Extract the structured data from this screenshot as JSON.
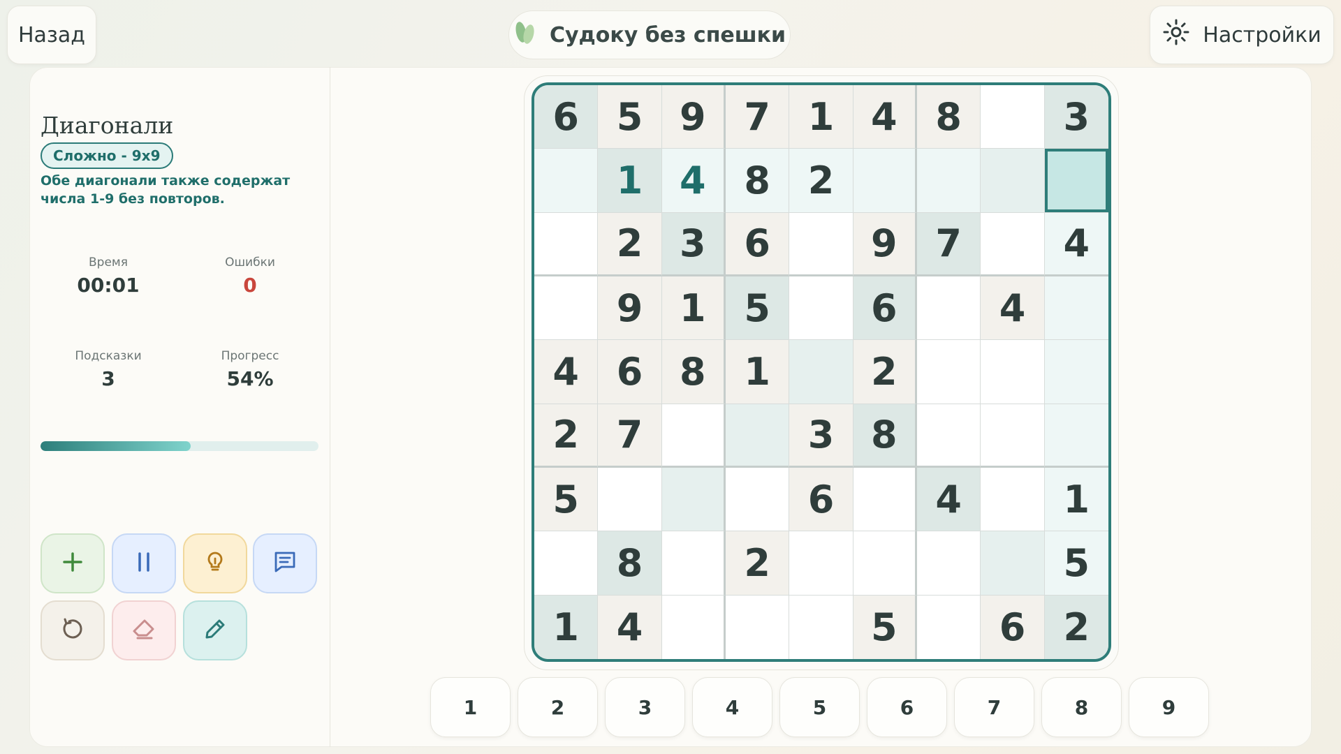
{
  "header": {
    "back_label": "Назад",
    "app_title": "Судоку без спешки",
    "settings_label": "Настройки"
  },
  "puzzle": {
    "title": "Диагонали",
    "difficulty": "Сложно - 9x9",
    "rule": "Обе диагонали также содержат числа 1-9 без повторов."
  },
  "stats": {
    "time_label": "Время",
    "time_value": "00:01",
    "errors_label": "Ошибки",
    "errors_value": "0",
    "hints_label": "Подсказки",
    "hints_value": "3",
    "progress_label": "Прогресс",
    "progress_value": "54%"
  },
  "progress_fraction": 0.54,
  "tools": [
    "plus-icon",
    "pause-icon",
    "lightbulb-icon",
    "notes-icon",
    "undo-icon",
    "eraser-icon",
    "pencil-icon"
  ],
  "board": {
    "selected": [
      1,
      8
    ],
    "entered": [
      [
        1,
        1
      ],
      [
        1,
        2
      ]
    ],
    "cells": [
      [
        "6",
        "5",
        "9",
        "7",
        "1",
        "4",
        "8",
        "",
        "3"
      ],
      [
        "",
        "1",
        "4",
        "8",
        "2",
        "",
        "",
        "",
        ""
      ],
      [
        "",
        "2",
        "3",
        "6",
        "",
        "9",
        "7",
        "",
        "4"
      ],
      [
        "",
        "9",
        "1",
        "5",
        "",
        "6",
        "",
        "4",
        ""
      ],
      [
        "4",
        "6",
        "8",
        "1",
        "",
        "2",
        "",
        "",
        ""
      ],
      [
        "2",
        "7",
        "",
        "",
        "3",
        "8",
        "",
        "",
        ""
      ],
      [
        "5",
        "",
        "",
        "",
        "6",
        "",
        "4",
        "",
        "1"
      ],
      [
        "",
        "8",
        "",
        "2",
        "",
        "",
        "",
        "",
        "5"
      ],
      [
        "1",
        "4",
        "",
        "",
        "",
        "5",
        "",
        "6",
        "2"
      ]
    ]
  },
  "numpad": [
    "1",
    "2",
    "3",
    "4",
    "5",
    "6",
    "7",
    "8",
    "9"
  ],
  "colors": {
    "accent": "#2e7d79",
    "error": "#c9463c"
  }
}
